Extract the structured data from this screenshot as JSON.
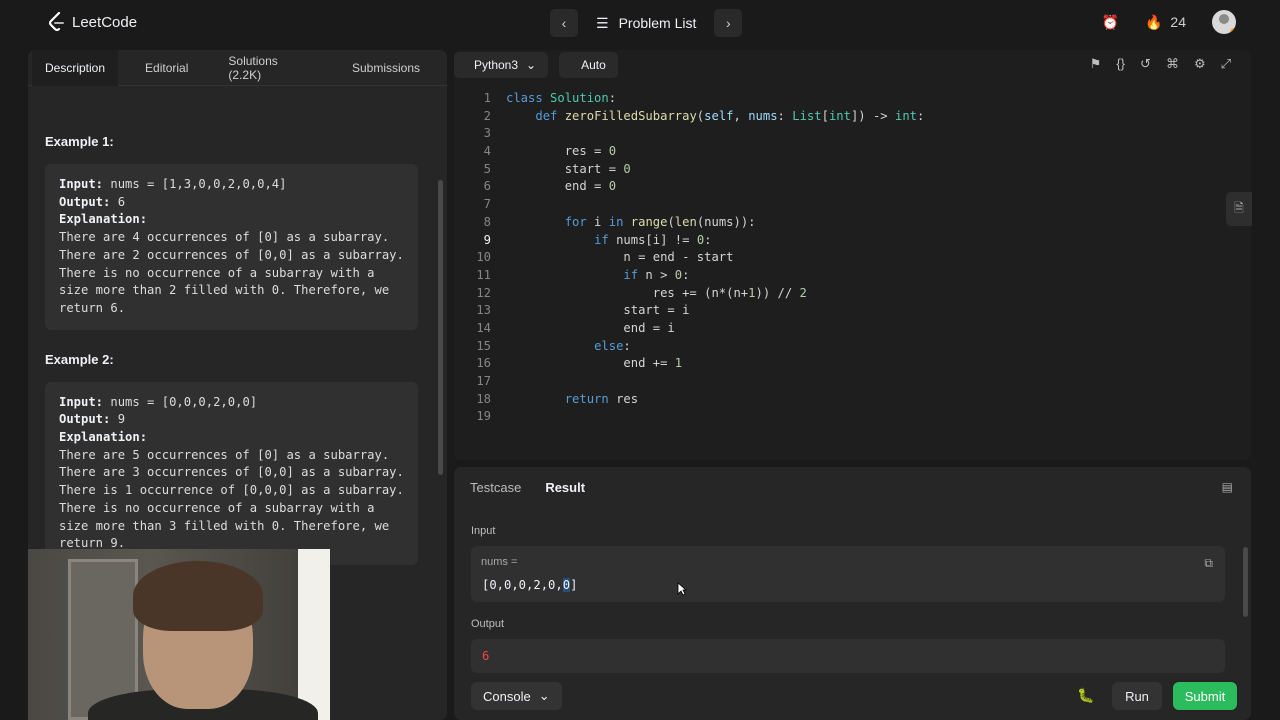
{
  "header": {
    "logo_text": "LeetCode",
    "problem_list_label": "Problem List",
    "streak_count": "24"
  },
  "left_tabs": [
    {
      "label": "Description"
    },
    {
      "label": "Editorial"
    },
    {
      "label": "Solutions (2.2K)"
    },
    {
      "label": "Submissions"
    }
  ],
  "examples": [
    {
      "title": "Example 1:",
      "input_label": "Input:",
      "input": " nums = [1,3,0,0,2,0,0,4]",
      "output_label": "Output:",
      "output": " 6",
      "explanation_label": "Explanation:",
      "explanation": "There are 4 occurrences of [0] as a subarray.\nThere are 2 occurrences of [0,0] as a subarray.\nThere is no occurrence of a subarray with a size more than 2 filled with 0. Therefore, we return 6."
    },
    {
      "title": "Example 2:",
      "input_label": "Input:",
      "input": " nums = [0,0,0,2,0,0]",
      "output_label": "Output:",
      "output": " 9",
      "explanation_label": "Explanation:",
      "explanation": "There are 5 occurrences of [0] as a subarray.\nThere are 3 occurrences of [0,0] as a subarray.\nThere is 1 occurrence of [0,0,0] as a subarray.\nThere is no occurrence of a subarray with a size more than 3 filled with 0. Therefore, we return 9."
    }
  ],
  "editor": {
    "language": "Python3",
    "auto_label": "Auto",
    "current_line": 9,
    "lines": [
      "1",
      "2",
      "3",
      "4",
      "5",
      "6",
      "7",
      "8",
      "9",
      "10",
      "11",
      "12",
      "13",
      "14",
      "15",
      "16",
      "17",
      "18",
      "19"
    ]
  },
  "result_panel": {
    "tab_testcase": "Testcase",
    "tab_result": "Result",
    "input_label": "Input",
    "var_label": "nums =",
    "input_value_pre": "[0,0,0,2,0,",
    "input_value_sel": "0",
    "input_value_post": "]",
    "output_label": "Output",
    "output_value": "6",
    "console_label": "Console",
    "run_label": "Run",
    "submit_label": "Submit"
  }
}
